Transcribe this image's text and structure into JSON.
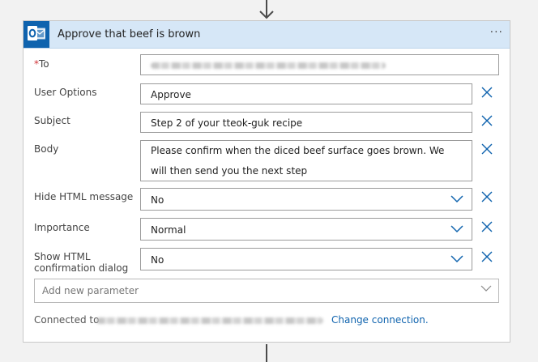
{
  "card": {
    "title": "Approve that beef is brown",
    "menu_glyph": "···",
    "icon": "outlook-icon",
    "accent_color": "#0f63ae",
    "header_color": "#d6e7f7"
  },
  "fields": {
    "to": {
      "required_mark": "*",
      "label": "To",
      "value_redacted": true
    },
    "user_options": {
      "label": "User Options",
      "value": "Approve"
    },
    "subject": {
      "label": "Subject",
      "value": "Step 2 of your tteok-guk recipe"
    },
    "body": {
      "label": "Body",
      "value": "Please confirm when the diced beef surface goes brown. We will then send you the next step"
    },
    "hide_html": {
      "label": "Hide HTML message",
      "value": "No"
    },
    "importance": {
      "label": "Importance",
      "value": "Normal"
    },
    "show_html_confirm": {
      "label": "Show HTML confirmation dialog",
      "value": "No"
    }
  },
  "add_parameter": {
    "placeholder": "Add new parameter"
  },
  "connection": {
    "label": "Connected to",
    "account_redacted": true,
    "change_label": "Change connection."
  }
}
